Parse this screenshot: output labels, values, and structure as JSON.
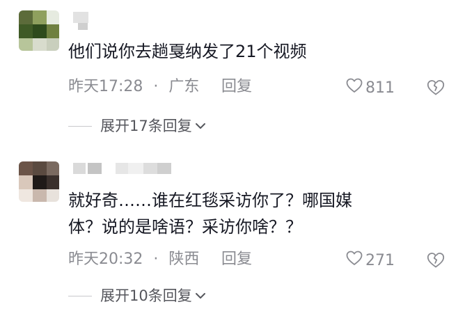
{
  "comments": [
    {
      "text": "他们说你去趟戛纳发了21个视频",
      "time": "昨天17:28",
      "separator": "·",
      "location": "广东",
      "reply_label": "回复",
      "likes": "811",
      "expand_label": "展开17条回复"
    },
    {
      "text_line1": "就好奇……谁在红毯采访你了？哪国媒",
      "text_line2": "体？说的是啥语？采访你啥？？",
      "time": "昨天20:32",
      "separator": "·",
      "location": "陕西",
      "reply_label": "回复",
      "likes": "271",
      "expand_label": "展开10条回复"
    }
  ],
  "icons": {
    "like": "heart-outline-icon",
    "dislike": "broken-heart-outline-icon",
    "expand": "chevron-down-icon"
  },
  "colors": {
    "text": "#161823",
    "meta": "#8a8b91",
    "expand": "#55565c"
  }
}
